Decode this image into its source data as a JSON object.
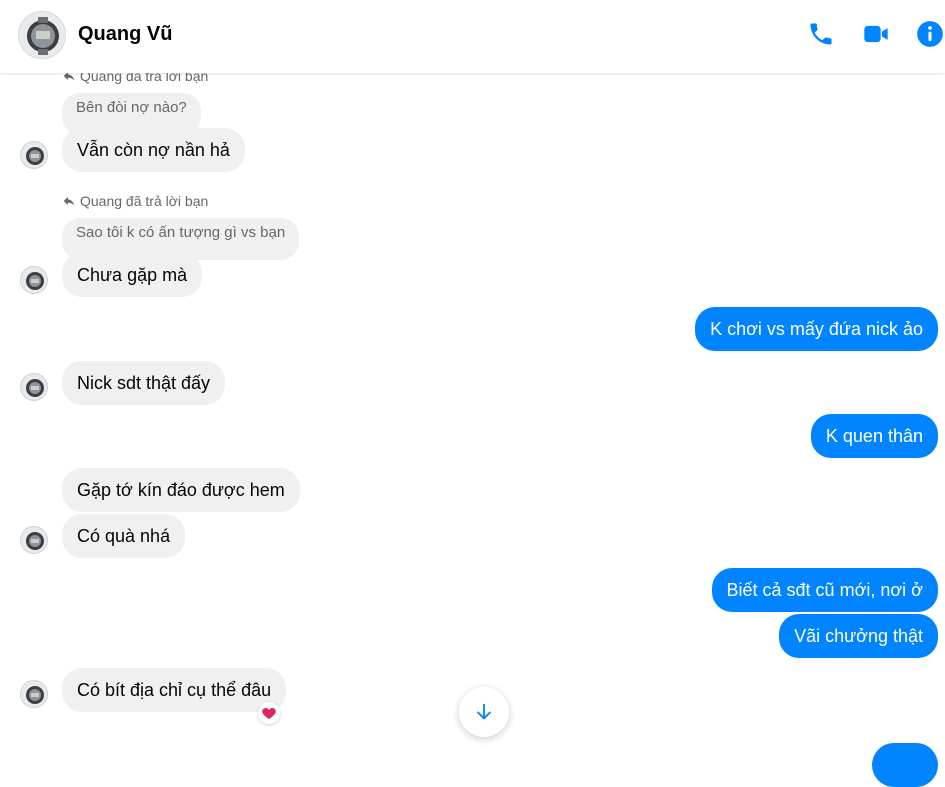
{
  "header": {
    "contact_name": "Quang Vũ",
    "icons": [
      "phone-icon",
      "video-camera-icon",
      "info-icon"
    ]
  },
  "colors": {
    "accent": "#0084ff",
    "incoming_bubble": "#f0f0f0",
    "secondary_text": "#65676b",
    "reaction": "#e0245e"
  },
  "messages": {
    "reply1": {
      "note": "Quang đã trả lời bạn",
      "quoted": "Bên đòi nợ nào?",
      "text": "Vẫn còn nợ nần hả"
    },
    "reply2": {
      "note": "Quang đã trả lời bạn",
      "quoted": "Sao tôi k có ấn tượng gì vs bạn",
      "text": "Chưa gặp mà"
    },
    "out1": "K chơi vs mấy đứa nick ảo",
    "in1": "Nick sdt thật đấy",
    "out2": "K quen thân",
    "in2": "Gặp tớ kín đáo được hem",
    "in3": "Có quà nhá",
    "out3": "Biết cả sđt cũ mới, nơi ở",
    "out4": "Vãi chưởng thật",
    "in4": "Có bít địa chỉ cụ thể đâu",
    "in4_reaction": "heart"
  }
}
